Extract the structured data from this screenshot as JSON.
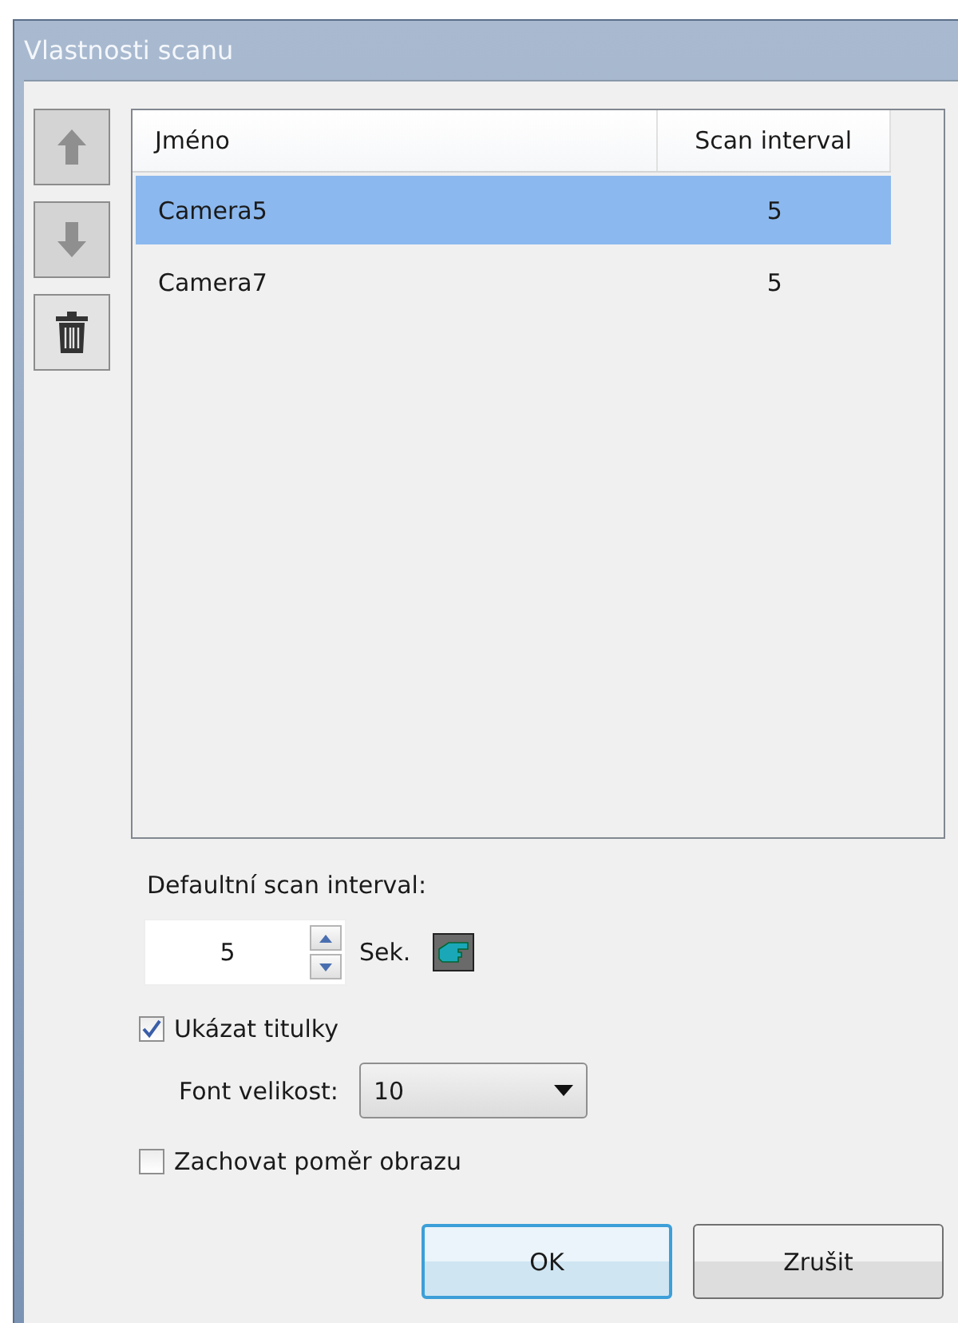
{
  "window": {
    "title": "Vlastnosti scanu"
  },
  "side_buttons": [
    {
      "kind": "up",
      "disabled": true
    },
    {
      "kind": "down",
      "disabled": true
    },
    {
      "kind": "delete",
      "disabled": false
    }
  ],
  "table": {
    "columns": [
      "Jméno",
      "Scan interval"
    ],
    "rows": [
      {
        "name": "Camera5",
        "interval": "5",
        "selected": true
      },
      {
        "name": "Camera7",
        "interval": "5",
        "selected": false
      }
    ]
  },
  "default_interval": {
    "label": "Defaultní scan interval:",
    "value": "5",
    "unit": "Sek."
  },
  "show_titles": {
    "label": "Ukázat titulky",
    "checked": true
  },
  "font_size": {
    "label": "Font velikost:",
    "value": "10"
  },
  "keep_ratio": {
    "label": "Zachovat poměr obrazu",
    "checked": false
  },
  "buttons": [
    {
      "label": "OK",
      "default": true
    },
    {
      "label": "Zrušit",
      "default": false
    }
  ]
}
